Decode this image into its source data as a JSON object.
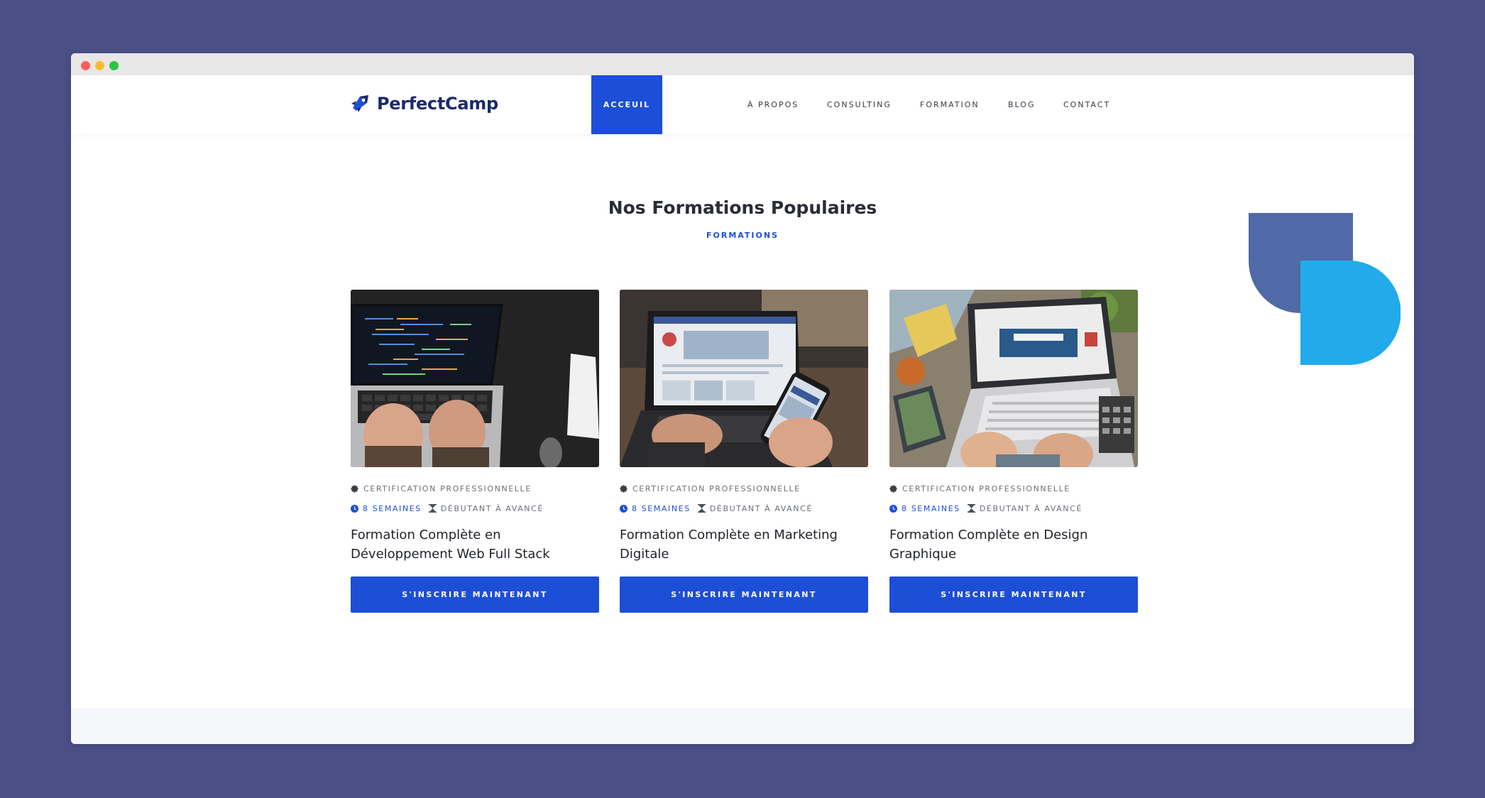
{
  "colors": {
    "background": "#4a4f86",
    "accent": "#1d4ed8",
    "brand_text": "#1b2a6b",
    "deco_dark": "#4f6aa6",
    "deco_light": "#22aaeb"
  },
  "logo": {
    "text": "PerfectCamp",
    "icon": "rocket-icon"
  },
  "nav": {
    "items": [
      {
        "label": "ACCEUIL",
        "active": true
      },
      {
        "label": "À PROPOS",
        "active": false
      },
      {
        "label": "CONSULTING",
        "active": false
      },
      {
        "label": "FORMATION",
        "active": false
      },
      {
        "label": "BLOG",
        "active": false
      },
      {
        "label": "CONTACT",
        "active": false
      }
    ]
  },
  "section": {
    "title": "Nos Formations Populaires",
    "subtitle": "FORMATIONS"
  },
  "courses": [
    {
      "image": "laptop-code-photo",
      "certification": "CERTIFICATION PROFESSIONNELLE",
      "duration": "8 SEMAINES",
      "level": "DÉBUTANT À AVANCÉ",
      "title": "Formation Complète en Développement Web Full Stack",
      "button": "S'INSCRIRE MAINTENANT"
    },
    {
      "image": "laptop-phone-marketing-photo",
      "certification": "CERTIFICATION PROFESSIONNELLE",
      "duration": "8 SEMAINES",
      "level": "DÉBUTANT À AVANCÉ",
      "title": "Formation Complète en Marketing Digitale",
      "button": "S'INSCRIRE MAINTENANT"
    },
    {
      "image": "laptop-design-desk-photo",
      "certification": "CERTIFICATION PROFESSIONNELLE",
      "duration": "8 SEMAINES",
      "level": "DÉBUTANT À AVANCÉ",
      "title": "Formation Complète en Design Graphique",
      "button": "S'INSCRIRE MAINTENANT"
    }
  ]
}
